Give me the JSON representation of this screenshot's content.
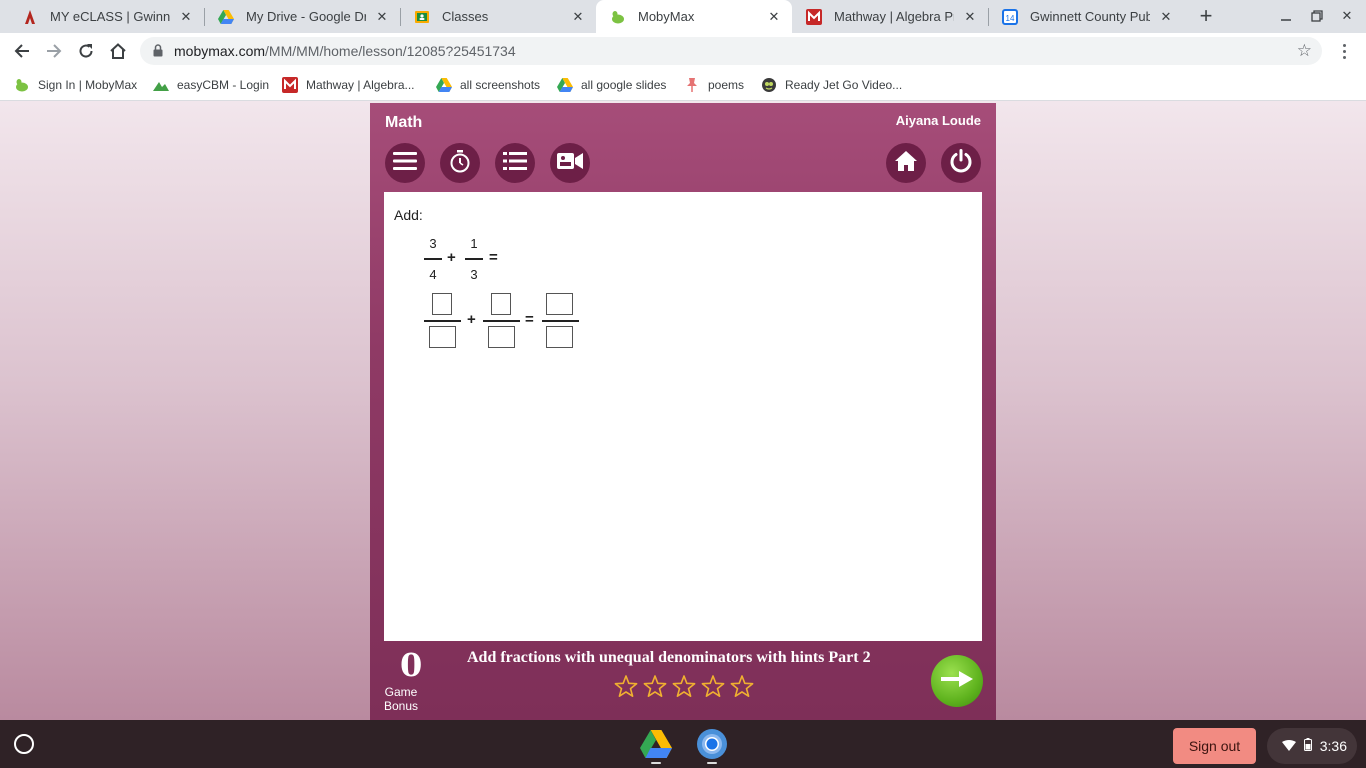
{
  "browser": {
    "tabs": [
      {
        "title": "MY eCLASS | Gwinnett C",
        "favicon": "eclass-icon"
      },
      {
        "title": "My Drive - Google Drive",
        "favicon": "google-drive-icon"
      },
      {
        "title": "Classes",
        "favicon": "classroom-icon"
      },
      {
        "title": "MobyMax",
        "favicon": "mobymax-icon",
        "active": true
      },
      {
        "title": "Mathway | Algebra Prob",
        "favicon": "mathway-icon"
      },
      {
        "title": "Gwinnett County Public",
        "favicon": "calendar-icon"
      }
    ],
    "url_host": "mobymax.com",
    "url_path": "/MM/MM/home/lesson/12085?25451734",
    "bookmarks": [
      {
        "label": "Sign In | MobyMax",
        "icon": "mobymax-icon"
      },
      {
        "label": "easyCBM - Login",
        "icon": "easycbm-icon"
      },
      {
        "label": "Mathway | Algebra...",
        "icon": "mathway-icon"
      },
      {
        "label": "all screenshots",
        "icon": "google-drive-icon"
      },
      {
        "label": "all google slides",
        "icon": "google-drive-icon"
      },
      {
        "label": "poems",
        "icon": "pin-icon"
      },
      {
        "label": "Ready Jet Go Video...",
        "icon": "pbs-icon"
      }
    ]
  },
  "app": {
    "subject": "Math",
    "student_name": "Aiyana Loude",
    "toolbar_left": [
      "menu-icon",
      "timer-icon",
      "list-icon",
      "video-icon"
    ],
    "toolbar_right": [
      "home-icon",
      "power-icon"
    ]
  },
  "problem": {
    "instruction": "Add:",
    "fraction1": {
      "numerator": "3",
      "denominator": "4"
    },
    "fraction2": {
      "numerator": "1",
      "denominator": "3"
    },
    "plus": "+",
    "equals": "=",
    "answer_boxes": 6
  },
  "footer": {
    "score": "0",
    "score_label_line1": "Game",
    "score_label_line2": "Bonus",
    "lesson_title": "Add fractions with unequal denominators with hints Part 2",
    "stars_filled": 0,
    "stars_total": 5
  },
  "shelf": {
    "sign_out": "Sign out",
    "time": "3:36",
    "apps": [
      "google-drive-icon",
      "chrome-icon"
    ]
  }
}
